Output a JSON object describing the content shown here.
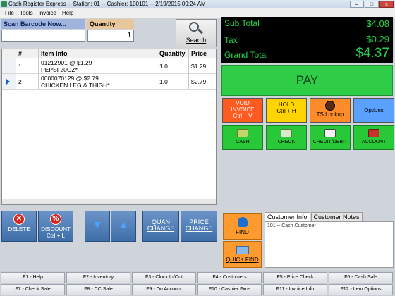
{
  "window": {
    "title": "Cash Register Express -- Station: 01 -- Cashier: 100101 -- 2/19/2015 09:24 AM",
    "buttons": [
      "–",
      "□",
      "x"
    ]
  },
  "menu": [
    "File",
    "Tools",
    "Invoice",
    "Help"
  ],
  "scan": {
    "label": "Scan Barcode Now...",
    "value": ""
  },
  "quantity": {
    "label": "Quantity",
    "value": "1"
  },
  "search": {
    "label": "Search",
    "icon": "magnifier-icon"
  },
  "grid": {
    "headers": {
      "num": "#",
      "info": "Item Info",
      "qty": "Quantity",
      "price": "Price"
    },
    "rows": [
      {
        "num": "1",
        "line1": "01212901 @  $1.29",
        "line2": "PEPSI 20OZ*",
        "qty": "1.0",
        "price": "$1.29"
      },
      {
        "num": "2",
        "line1": "0000070129 @  $2.79",
        "line2": "CHICKEN LEG & THIGH*",
        "qty": "1.0",
        "price": "$2.79"
      }
    ]
  },
  "actions": {
    "delete": "DELETE",
    "discount": [
      "DISCOUNT",
      "Ctrl + L"
    ],
    "quan_change": [
      "QUAN",
      "CHANGE"
    ],
    "price_change": [
      "PRICE",
      "CHANGE"
    ]
  },
  "totals": {
    "subtotal_label": "Sub Total",
    "subtotal": "$4.08",
    "tax_label": "Tax",
    "tax": "$0.29",
    "grand_label": "Grand Total",
    "grand": "$4.37"
  },
  "pay": "PAY",
  "commands": {
    "void": [
      "VOID",
      "INVOICE",
      "Ctrl + V"
    ],
    "hold": [
      "HOLD",
      "Ctrl + H"
    ],
    "ts": "TS Lookup",
    "options": "Options"
  },
  "tender": {
    "cash": "CASH",
    "check": "CHECK",
    "credit": "CREDIT/DEBIT",
    "account": "ACCOUNT"
  },
  "customer": {
    "find": "FIND",
    "quick_find": "QUICK FIND",
    "tabs": [
      "Customer Info",
      "Customer Notes"
    ],
    "info": "101 -- Cash Customer"
  },
  "fkeys": [
    "F1 - Help",
    "F2 - Inventory",
    "F3 - Clock In/Out",
    "F4 - Customers",
    "F5 - Price Check",
    "F6 - Cash Sale",
    "F7 - Check Sale",
    "F8 - CC Sale",
    "F9 - On Account",
    "F10 - Cashier Fxns",
    "F11 - Invoice Info",
    "F12 - Item Options"
  ],
  "colors": {
    "total_green": "#24d24a",
    "pay_green": "#2ecc47",
    "accent_blue": "#3e6ea8"
  }
}
